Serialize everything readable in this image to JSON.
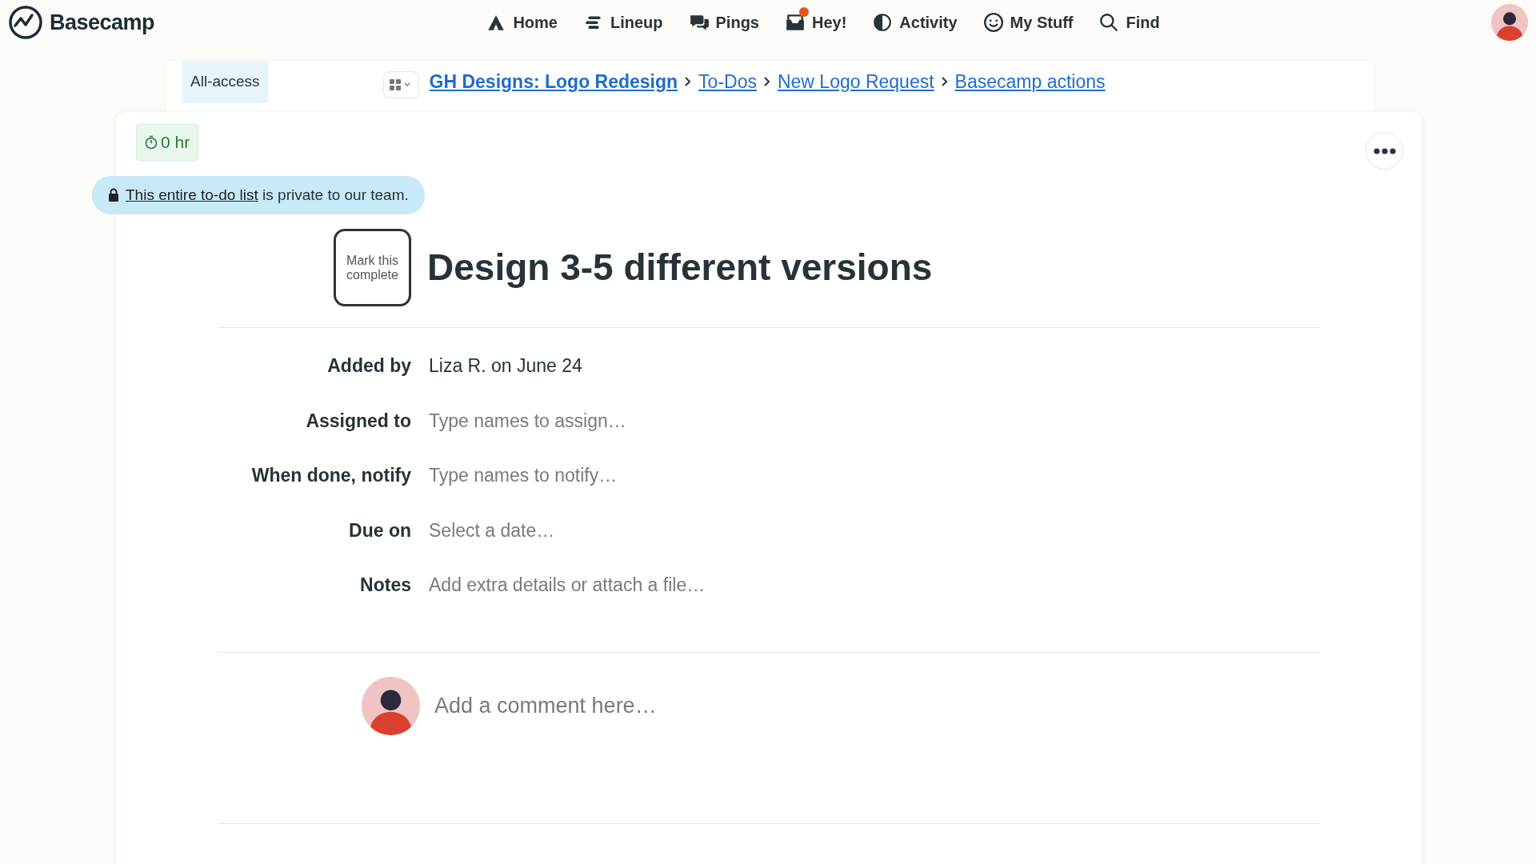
{
  "app": {
    "name": "Basecamp"
  },
  "nav": [
    {
      "label": "Home",
      "kind": "home",
      "unread": false
    },
    {
      "label": "Lineup",
      "kind": "lineup",
      "unread": false
    },
    {
      "label": "Pings",
      "kind": "pings",
      "unread": false
    },
    {
      "label": "Hey!",
      "kind": "hey",
      "unread": true
    },
    {
      "label": "Activity",
      "kind": "activity",
      "unread": false
    },
    {
      "label": "My Stuff",
      "kind": "smiley",
      "unread": false
    },
    {
      "label": "Find",
      "kind": "search",
      "unread": false
    }
  ],
  "breadcrumb": {
    "tag": "All-access",
    "items": [
      {
        "label": "GH Designs: Logo Redesign",
        "bold": true
      },
      {
        "label": "To-Dos",
        "bold": false
      },
      {
        "label": "New Logo Request",
        "bold": false
      },
      {
        "label": "Basecamp actions",
        "bold": false
      }
    ]
  },
  "timer": "0 hr",
  "privacy": {
    "link": "This entire to-do list",
    "text": "is private to our team."
  },
  "todo": {
    "complete_button": "Mark this complete",
    "title": "Design 3-5 different versions"
  },
  "fields": [
    {
      "label": "Added by",
      "value": "Liza R. on June 24"
    },
    {
      "label": "Assigned to",
      "placeholder": "Type names to assign…"
    },
    {
      "label": "When done, notify",
      "placeholder": "Type names to notify…"
    },
    {
      "label": "Due on",
      "placeholder": "Select a date…"
    },
    {
      "label": "Notes",
      "placeholder": "Add extra details or attach a file…"
    }
  ],
  "comment": {
    "placeholder": "Add a comment here…"
  }
}
